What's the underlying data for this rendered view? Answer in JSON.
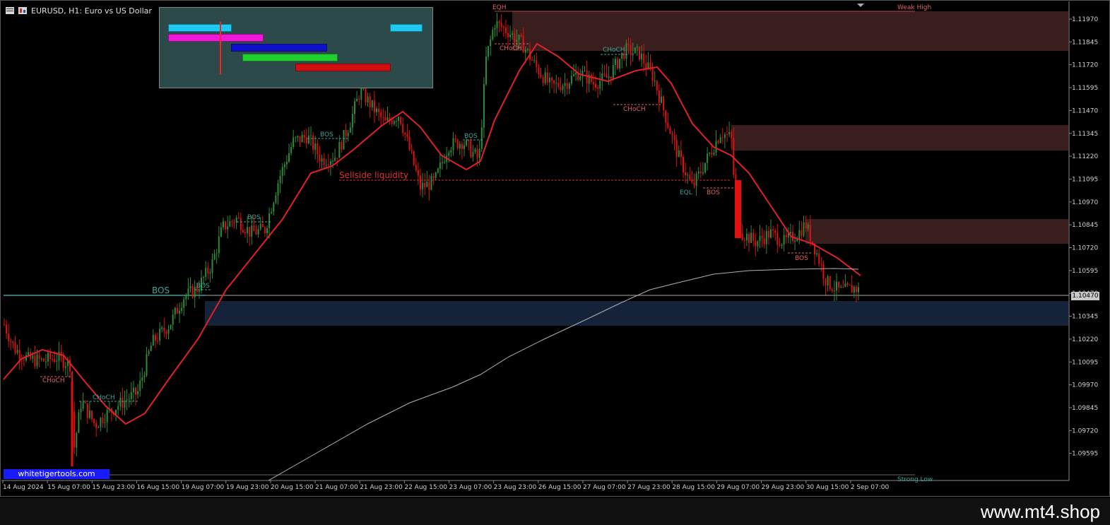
{
  "window": {
    "title": "EURUSD, H1:  Euro vs US Dollar"
  },
  "price_axis": {
    "labels": [
      "1.11970",
      "1.11845",
      "1.11720",
      "1.11595",
      "1.11470",
      "1.11345",
      "1.11220",
      "1.11095",
      "1.10970",
      "1.10845",
      "1.10720",
      "1.10595",
      "1.10470",
      "1.10345",
      "1.10220",
      "1.10095",
      "1.09970",
      "1.09845",
      "1.09720",
      "1.09595"
    ],
    "current_price": "1.10470"
  },
  "time_axis": {
    "labels": [
      "14 Aug 2024",
      "15 Aug 07:00",
      "15 Aug 23:00",
      "16 Aug 15:00",
      "19 Aug 07:00",
      "19 Aug 23:00",
      "20 Aug 15:00",
      "21 Aug 07:00",
      "21 Aug 23:00",
      "22 Aug 15:00",
      "23 Aug 07:00",
      "23 Aug 23:00",
      "26 Aug 15:00",
      "27 Aug 07:00",
      "27 Aug 23:00",
      "28 Aug 15:00",
      "29 Aug 07:00",
      "29 Aug 23:00",
      "30 Aug 15:00",
      "2 Sep 07:00"
    ]
  },
  "annotations": {
    "bos_big": "BOS",
    "bos": "BOS",
    "choch": "CHoCH",
    "eqh": "EQH",
    "eql": "EQL",
    "weak_high": "Weak High",
    "strong_low": "Strong Low",
    "sellside": "Sellside liquidity"
  },
  "brand": {
    "badge": "whitetigertools.com",
    "watermark": "www.mt4.shop"
  },
  "colors": {
    "bull": "#2e8b3a",
    "bear": "#e01010",
    "ma_fast": "#e0202a",
    "ma_slow": "#b0b0b0",
    "bos_label": "#3aa39a",
    "choch_label": "#e06060",
    "zone_supply": "#3a1e1e",
    "zone_demand": "#15233a"
  }
}
